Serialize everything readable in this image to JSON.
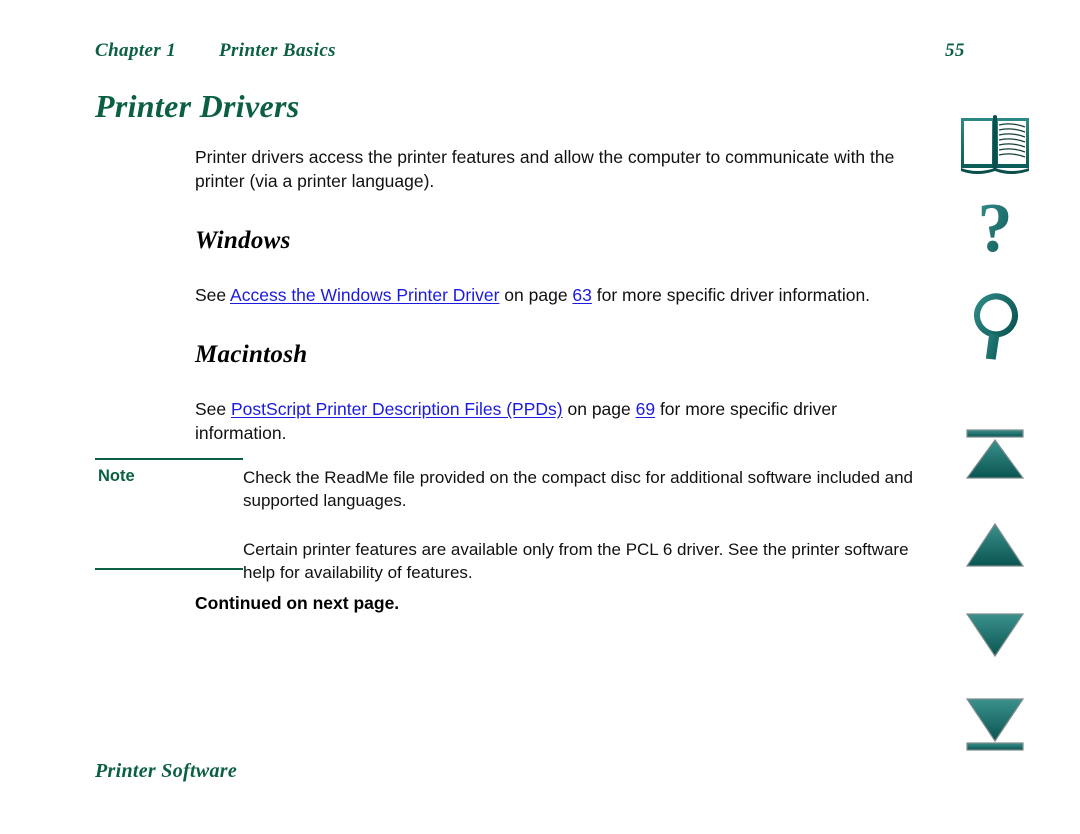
{
  "header": {
    "chapter": "Chapter 1",
    "section": "Printer Basics",
    "page_number": "55"
  },
  "page": {
    "heading": "Printer Drivers",
    "intro": "Printer drivers access the printer features and allow the computer to communicate with the printer (via a printer language)."
  },
  "windows": {
    "heading": "Windows",
    "see_label": "See ",
    "link_text": "Access the Windows Printer Driver",
    "mid_text": " on page ",
    "page_link": "63",
    "tail_text": " for more specific driver information."
  },
  "macintosh": {
    "heading": "Macintosh",
    "see_label": "See ",
    "link_text": "PostScript Printer Description Files (PPDs)",
    "mid_text": " on page ",
    "page_link": "69",
    "tail_text": " for more specific driver information."
  },
  "note": {
    "label": "Note",
    "paragraph_1": "Check the ReadMe file provided on the compact disc for additional software included and supported languages.",
    "paragraph_2": "Certain printer features are available only from the PCL 6 driver. See the printer software help for availability of features."
  },
  "continued": "Continued on next page.",
  "footer": {
    "title": "Printer Software"
  },
  "icons": [
    {
      "name": "book-icon",
      "label": "Table of contents"
    },
    {
      "name": "question-mark-icon",
      "label": "Help"
    },
    {
      "name": "magnifier-icon",
      "label": "Search"
    },
    {
      "name": "first-page-icon",
      "label": "First page"
    },
    {
      "name": "previous-page-icon",
      "label": "Previous page"
    },
    {
      "name": "next-page-icon",
      "label": "Next page"
    },
    {
      "name": "last-page-icon",
      "label": "Last page"
    }
  ],
  "colors": {
    "heading_green": "#0b6042",
    "icon_teal": "#0e6b6b",
    "link_blue": "#1a1ae0",
    "body_black": "#111111"
  }
}
